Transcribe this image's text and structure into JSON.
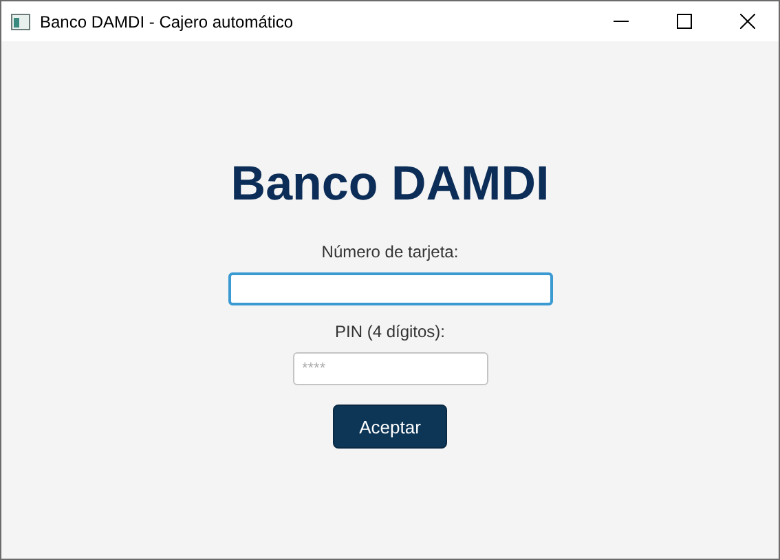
{
  "window": {
    "title": "Banco DAMDI - Cajero automático"
  },
  "heading": "Banco DAMDI",
  "card_field": {
    "label": "Número de tarjeta:",
    "focused": true
  },
  "pin_field": {
    "label": "PIN (4 dígitos):",
    "placeholder": "****"
  },
  "buttons": [
    "Aceptar"
  ]
}
